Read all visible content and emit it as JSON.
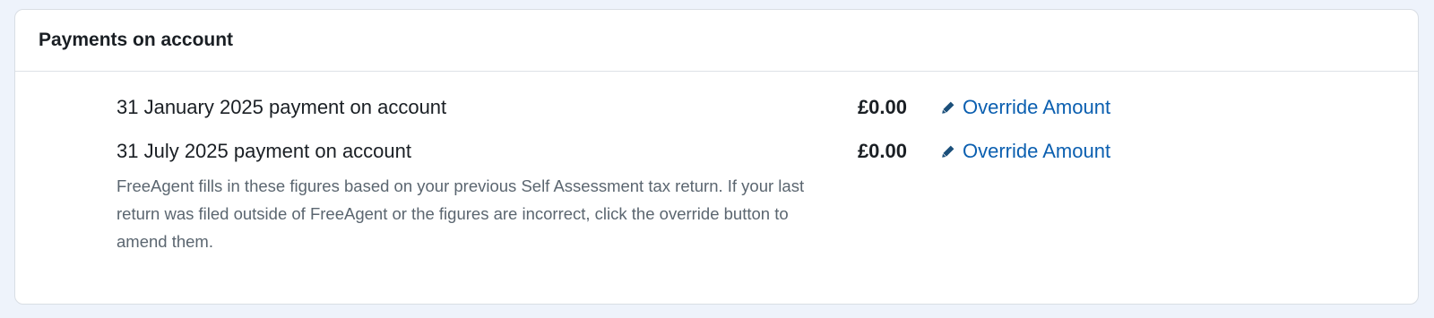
{
  "panel": {
    "title": "Payments on account"
  },
  "payments": [
    {
      "label": "31 January 2025 payment on account",
      "amount": "£0.00",
      "action_label": "Override Amount",
      "action_icon": "pencil-icon"
    },
    {
      "label": "31 July 2025 payment on account",
      "amount": "£0.00",
      "action_label": "Override Amount",
      "action_icon": "pencil-icon"
    }
  ],
  "help_text": "FreeAgent fills in these figures based on your previous Self Assessment tax return. If your last return was filed outside of FreeAgent or the figures are incorrect, click the override button to amend them.",
  "colors": {
    "page_background": "#eef3fb",
    "link": "#0b5fb0",
    "text": "#1a1f24",
    "muted_text": "#5b6670"
  }
}
